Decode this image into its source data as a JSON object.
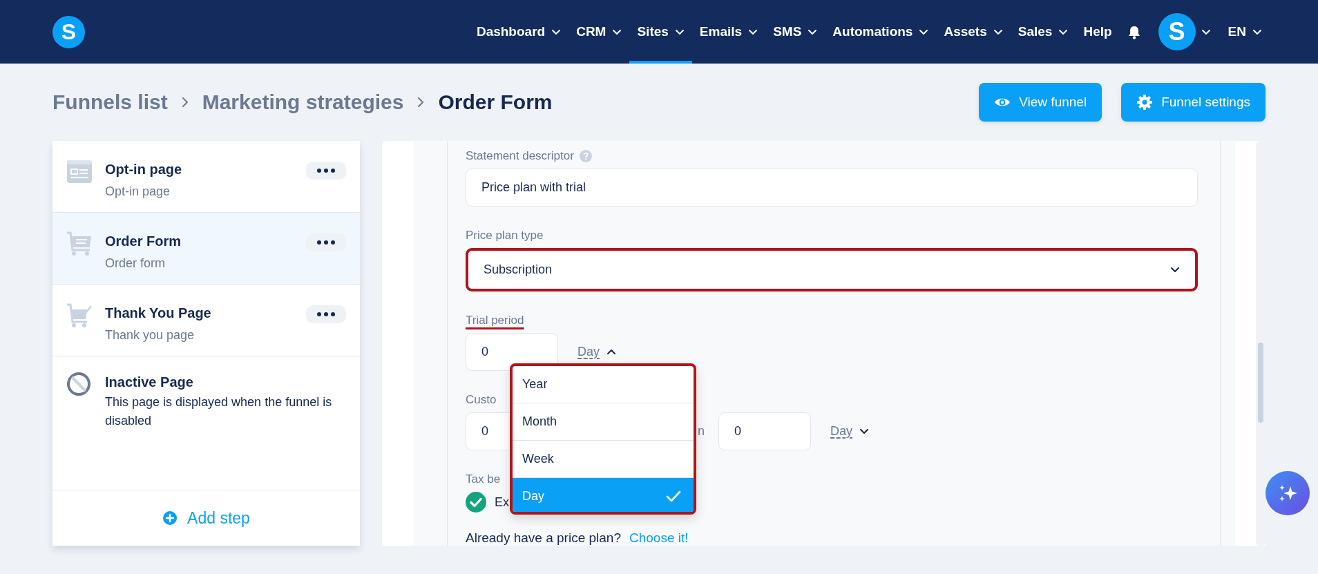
{
  "nav": {
    "logo": "S",
    "items": [
      {
        "label": "Dashboard",
        "has_menu": true,
        "selected": false
      },
      {
        "label": "CRM",
        "has_menu": true,
        "selected": false
      },
      {
        "label": "Sites",
        "has_menu": true,
        "selected": true
      },
      {
        "label": "Emails",
        "has_menu": true,
        "selected": false
      },
      {
        "label": "SMS",
        "has_menu": true,
        "selected": false
      },
      {
        "label": "Automations",
        "has_menu": true,
        "selected": false
      },
      {
        "label": "Assets",
        "has_menu": true,
        "selected": false
      },
      {
        "label": "Sales",
        "has_menu": true,
        "selected": false
      },
      {
        "label": "Help",
        "has_menu": false,
        "selected": false
      }
    ],
    "avatar": "S",
    "language": "EN"
  },
  "breadcrumb": [
    "Funnels list",
    "Marketing strategies",
    "Order Form"
  ],
  "header_buttons": [
    {
      "label": "View funnel",
      "kind": "view"
    },
    {
      "label": "Funnel settings",
      "kind": "settings"
    }
  ],
  "steps": [
    {
      "title": "Opt-in page",
      "subtitle": "Opt-in page",
      "kind": "optin",
      "selected": false
    },
    {
      "title": "Order Form",
      "subtitle": "Order form",
      "kind": "order",
      "selected": true
    },
    {
      "title": "Thank You Page",
      "subtitle": "Thank you page",
      "kind": "thanks",
      "selected": false
    },
    {
      "title": "Inactive Page",
      "subtitle": "This page is displayed when the funnel is disabled",
      "kind": "inactive",
      "selected": false
    }
  ],
  "add_step": "Add step",
  "form": {
    "statement_descriptor": {
      "label": "Statement descriptor",
      "value": "Price plan with trial"
    },
    "price_plan_type": {
      "label": "Price plan type",
      "value": "Subscription",
      "highlighted": true
    },
    "trial_period": {
      "label": "Trial period",
      "underlined": true,
      "value": "0",
      "unit": "Day",
      "expanded": true
    },
    "unit_menu": {
      "highlighted": true,
      "options": [
        {
          "label": "Year",
          "selected": false
        },
        {
          "label": "Month",
          "selected": false
        },
        {
          "label": "Week",
          "selected": false
        },
        {
          "label": "Day",
          "selected": true
        }
      ]
    },
    "custom": {
      "label": "Custo",
      "value_1": "0",
      "middle_text": "n",
      "value_2": "0",
      "unit": "Day",
      "expanded": false
    },
    "tax": {
      "label": "Tax be",
      "option": "Ex",
      "checked": true
    },
    "footer": {
      "question": "Already have a price plan?",
      "link": "Choose it!"
    }
  }
}
